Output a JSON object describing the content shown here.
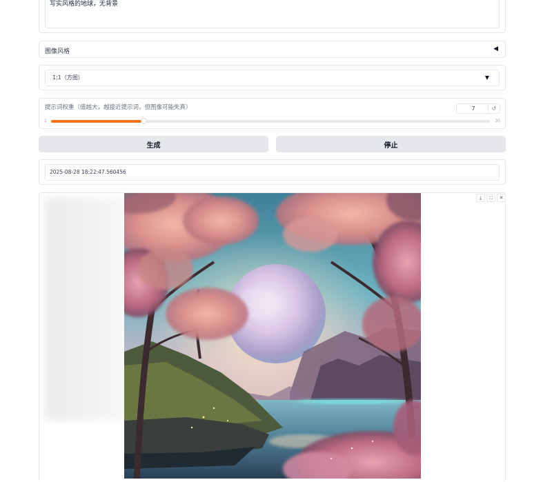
{
  "prompt": {
    "value": "写实风格的地球，无背景"
  },
  "style_accordion": {
    "label": "图像风格",
    "arrow": "◀"
  },
  "aspect_select": {
    "value": "1:1（方图）",
    "arrow": "▼"
  },
  "guidance": {
    "label": "提示词权重（值越大，越接近提示词，但图像可能失真）",
    "value": "7",
    "min": "1",
    "max": "30",
    "fraction": 0.21,
    "reset_icon": "↺"
  },
  "buttons": {
    "generate": "生成",
    "stop": "停止"
  },
  "timestamp": {
    "value": "2025-08-28 18:22:47.560456"
  },
  "image_toolbar": {
    "download_icon": "⤓",
    "fullscreen_icon": "⛶",
    "close_icon": "✕"
  },
  "colors": {
    "accent": "#f97316",
    "button_bg": "#e5e7eb",
    "border": "#e5e7eb"
  },
  "image": {
    "subject": "fantasy landscape with large moon between pink-blossom trees over a lake"
  }
}
